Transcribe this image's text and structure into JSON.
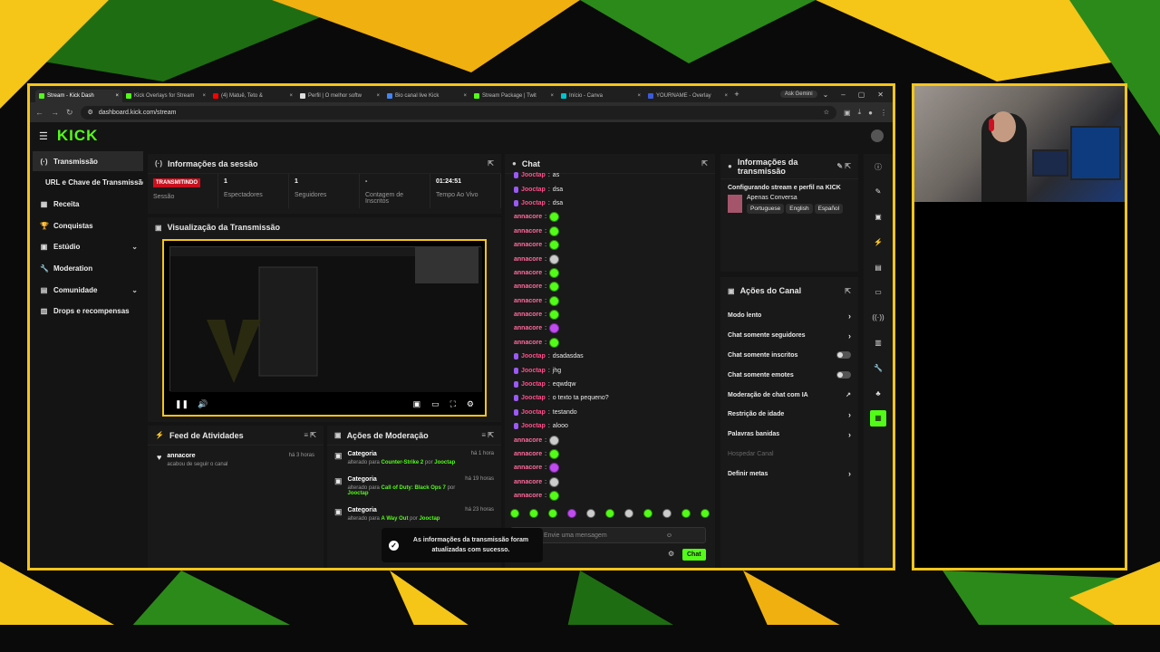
{
  "browser": {
    "tabs": [
      {
        "label": "Stream - Kick Dash",
        "color": "#53fc18",
        "active": true
      },
      {
        "label": "Kick Overlays for Stream",
        "color": "#53fc18"
      },
      {
        "label": "(4) Matuê, Teto &",
        "color": "#ff0000"
      },
      {
        "label": "Perfil | O melhor softw",
        "color": "#dddddd"
      },
      {
        "label": "Bio canal live Kick",
        "color": "#4285f4"
      },
      {
        "label": "Stream Package | Twit",
        "color": "#53fc18"
      },
      {
        "label": "Início - Canva",
        "color": "#00c4cc"
      },
      {
        "label": "YOURNAME - Overlay",
        "color": "#3b5bdb"
      }
    ],
    "new_tab": "+",
    "gemini": "Ask Gemini",
    "url": "dashboard.kick.com/stream"
  },
  "header": {
    "logo": "KICK"
  },
  "sidebar": {
    "items": [
      {
        "label": "Transmissão",
        "icon": "(·)",
        "active": true
      },
      {
        "label": "URL e Chave de Transmissão",
        "icon": ""
      },
      {
        "label": "Receita",
        "icon": "▦"
      },
      {
        "label": "Conquistas",
        "icon": "🏆"
      },
      {
        "label": "Estúdio",
        "icon": "▣",
        "chev": "⌄"
      },
      {
        "label": "Moderation",
        "icon": "🔧"
      },
      {
        "label": "Comunidade",
        "icon": "▤",
        "chev": "⌄"
      },
      {
        "label": "Drops e recompensas",
        "icon": "▥"
      }
    ]
  },
  "session": {
    "title": "Informações da sessão",
    "live_badge": "TRANSMITINDO",
    "session_label": "Sessão",
    "stats": [
      {
        "value": "1",
        "label": "Espectadores"
      },
      {
        "value": "1",
        "label": "Seguidores"
      },
      {
        "value": "-",
        "label": "Contagem de Inscritos"
      },
      {
        "value": "01:24:51",
        "label": "Tempo Ao Vivo"
      }
    ]
  },
  "preview": {
    "title": "Visualização da Transmissão"
  },
  "feed": {
    "title": "Feed de Atividades",
    "items": [
      {
        "user": "annacore",
        "text": "acabou de seguir o canal",
        "time": "há 3 horas"
      }
    ]
  },
  "moderation": {
    "title": "Ações de Moderação",
    "items": [
      {
        "title": "Categoria",
        "prefix": "alterado para",
        "game": "Counter-Strike 2",
        "by": "por",
        "user": "Jooctap",
        "time": "há 1 hora"
      },
      {
        "title": "Categoria",
        "prefix": "alterado para",
        "game": "Call of Duty: Black Ops 7",
        "by": "por",
        "user": "Jooctap",
        "time": "há 19 horas"
      },
      {
        "title": "Categoria",
        "prefix": "alterado para",
        "game": "A Way Out",
        "by": "por",
        "user": "Jooctap",
        "time": "há 23 horas"
      }
    ]
  },
  "chat": {
    "title": "Chat",
    "messages": [
      {
        "user": "Jooctap",
        "text": "as",
        "badge": true
      },
      {
        "user": "Jooctap",
        "text": "dsa",
        "badge": true
      },
      {
        "user": "Jooctap",
        "text": "dsa",
        "badge": true
      },
      {
        "user": "annacore",
        "emote": "green"
      },
      {
        "user": "annacore",
        "emote": "green"
      },
      {
        "user": "annacore",
        "emote": "green"
      },
      {
        "user": "annacore",
        "emote": "grey"
      },
      {
        "user": "annacore",
        "emote": "green"
      },
      {
        "user": "annacore",
        "emote": "green"
      },
      {
        "user": "annacore",
        "emote": "green"
      },
      {
        "user": "annacore",
        "emote": "green"
      },
      {
        "user": "annacore",
        "emote": "purple"
      },
      {
        "user": "annacore",
        "emote": "green"
      },
      {
        "user": "Jooctap",
        "text": "dsadasdas",
        "badge": true
      },
      {
        "user": "Jooctap",
        "text": "jhg",
        "badge": true
      },
      {
        "user": "Jooctap",
        "text": "eqwdqw",
        "badge": true
      },
      {
        "user": "Jooctap",
        "text": "o texto ta pequeno?",
        "badge": true
      },
      {
        "user": "Jooctap",
        "text": "testando",
        "badge": true
      },
      {
        "user": "Jooctap",
        "text": "alooo",
        "badge": true
      },
      {
        "user": "annacore",
        "emote": "grey"
      },
      {
        "user": "annacore",
        "emote": "green"
      },
      {
        "user": "annacore",
        "emote": "purple"
      },
      {
        "user": "annacore",
        "emote": "grey"
      },
      {
        "user": "annacore",
        "emote": "green"
      }
    ],
    "placeholder": "Envie uma mensagem",
    "send": "Chat"
  },
  "stream_info": {
    "title": "Informações da transmissão",
    "stream_title": "Configurando stream e perfil na KICK",
    "category": "Apenas Conversa",
    "tags": [
      "Portuguese",
      "English",
      "Español"
    ]
  },
  "channel_actions": {
    "title": "Ações do Canal",
    "options": [
      {
        "label": "Modo lento",
        "control": "chevron"
      },
      {
        "label": "Chat somente seguidores",
        "control": "chevron"
      },
      {
        "label": "Chat somente inscritos",
        "control": "toggle"
      },
      {
        "label": "Chat somente emotes",
        "control": "toggle"
      },
      {
        "label": "Moderação de chat com IA",
        "control": "external"
      },
      {
        "label": "Restrição de idade",
        "control": "chevron"
      },
      {
        "label": "Palavras banidas",
        "control": "chevron"
      },
      {
        "label": "Hospedar Canal",
        "control": "none",
        "disabled": true
      },
      {
        "label": "Definir metas",
        "control": "chevron"
      }
    ]
  },
  "toast": {
    "message": "As informações da transmissão foram atualizadas com sucesso."
  },
  "colors": {
    "accent": "#53fc18",
    "frame": "#f5c518",
    "live": "#c8101e"
  }
}
